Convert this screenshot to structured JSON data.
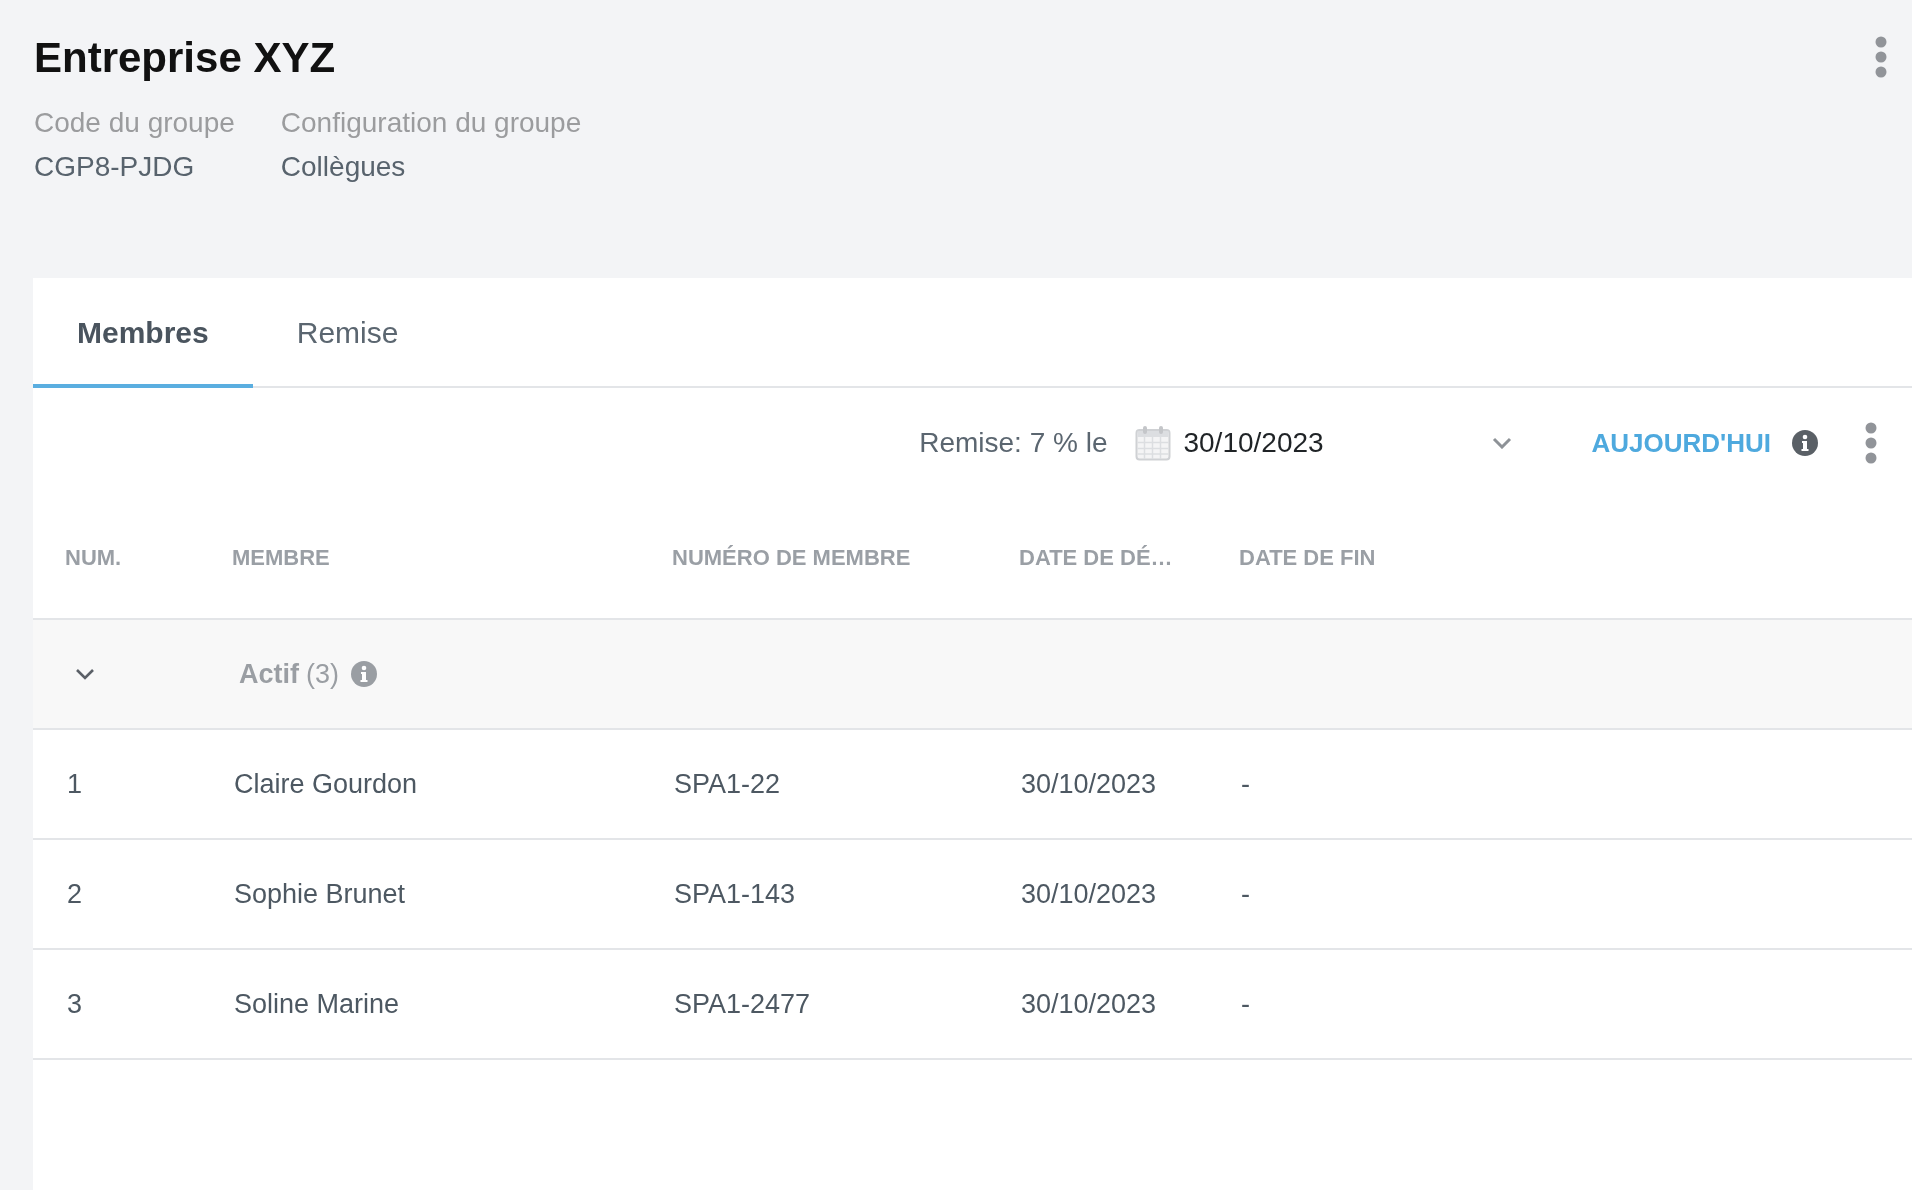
{
  "header": {
    "title": "Entreprise XYZ",
    "fields": [
      {
        "label": "Code du groupe",
        "value": "CGP8-PJDG"
      },
      {
        "label": "Configuration du groupe",
        "value": "Collègues"
      }
    ]
  },
  "tabs": [
    {
      "label": "Membres",
      "selected": true
    },
    {
      "label": "Remise",
      "selected": false
    }
  ],
  "toolbar": {
    "discount_label": "Remise: 7 % le",
    "date": "30/10/2023",
    "today_button": "AUJOURD'HUI"
  },
  "table": {
    "columns": [
      "NUM.",
      "MEMBRE",
      "NUMÉRO DE MEMBRE",
      "DATE DE DÉ…",
      "DATE DE FIN"
    ],
    "groups": [
      {
        "label": "Actif",
        "count": "(3)",
        "expanded": true,
        "rows": [
          [
            "1",
            "Claire Gourdon",
            "SPA1-22",
            "30/10/2023",
            "-"
          ],
          [
            "2",
            "Sophie Brunet",
            "SPA1-143",
            "30/10/2023",
            "-"
          ],
          [
            "3",
            "Soline Marine",
            "SPA1-2477",
            "30/10/2023",
            "-"
          ]
        ]
      }
    ]
  }
}
